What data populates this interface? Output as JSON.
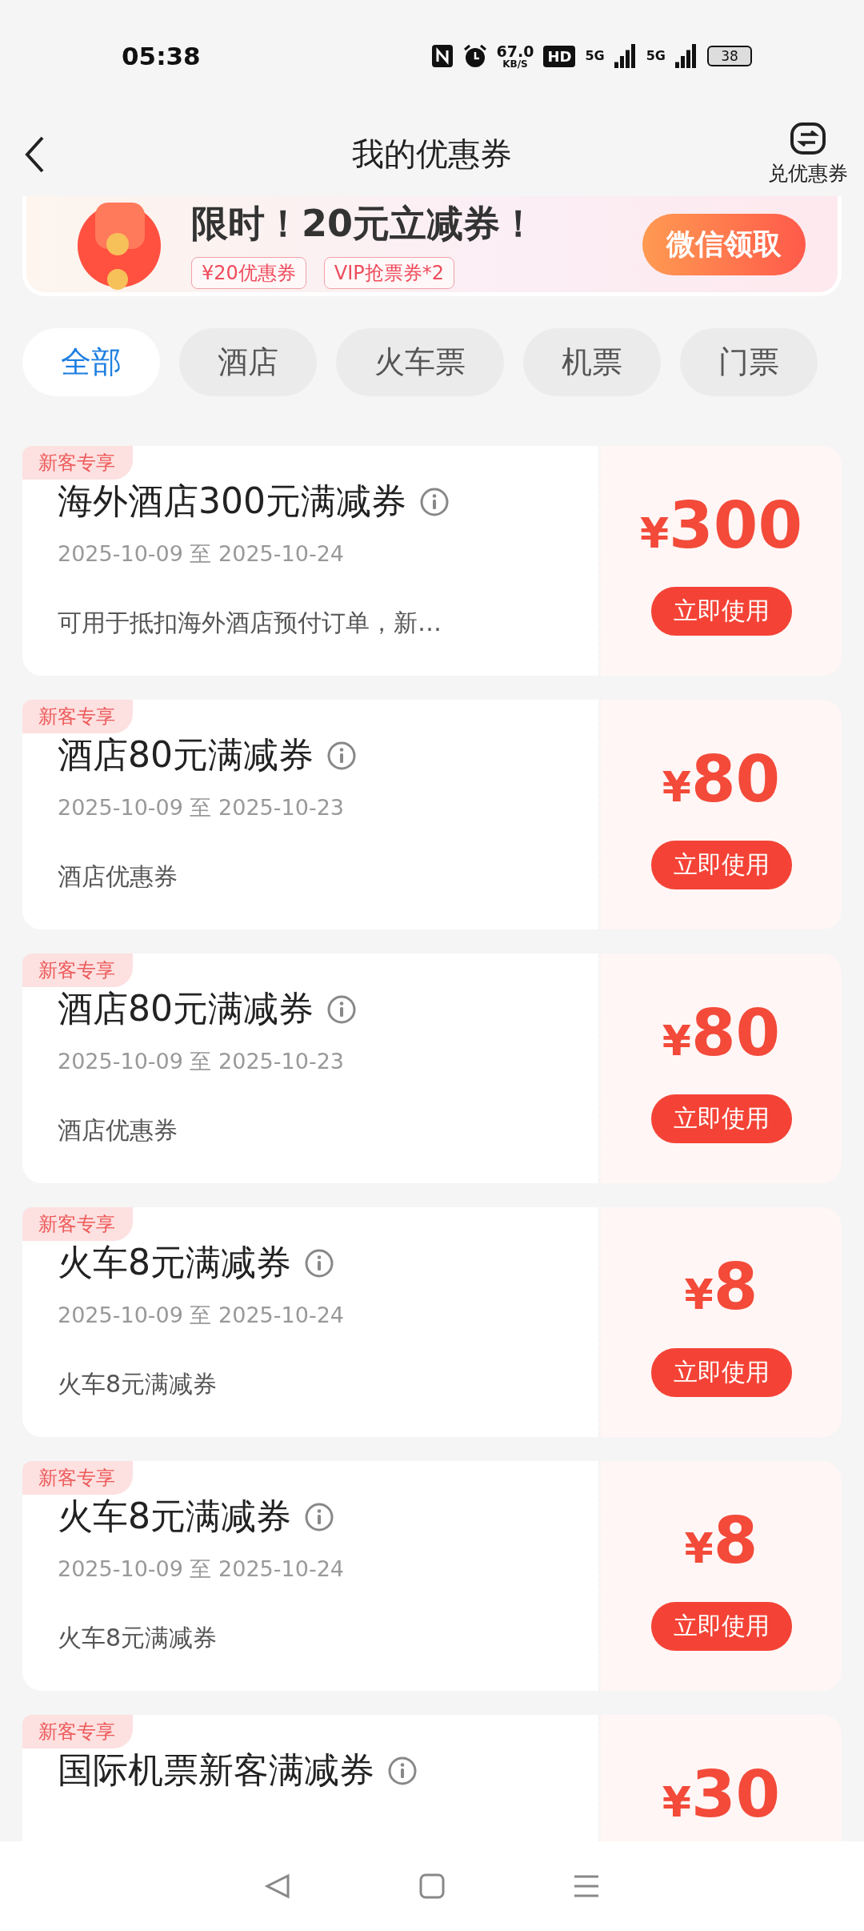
{
  "status_bar": {
    "time": "05:38",
    "speed": "67.0",
    "speed_unit": "KB/S",
    "hd": "HD",
    "network_1": "5G",
    "network_2": "5G",
    "battery": "38"
  },
  "header": {
    "title": "我的优惠券",
    "action": "兑优惠券"
  },
  "banner": {
    "headline": "限时！20元立减券！",
    "chips": [
      "¥20优惠券",
      "VIP抢票券*2"
    ],
    "button": "微信领取"
  },
  "tabs": [
    {
      "label": "全部",
      "selected": true
    },
    {
      "label": "酒店",
      "selected": false
    },
    {
      "label": "火车票",
      "selected": false
    },
    {
      "label": "机票",
      "selected": false
    },
    {
      "label": "门票",
      "selected": false
    }
  ],
  "coupons": [
    {
      "tag": "新客专享",
      "title": "海外酒店300元满减券",
      "dates": "2025-10-09 至 2025-10-24",
      "description": "可用于抵扣海外酒店预付订单，新…",
      "currency": "¥",
      "amount": "300",
      "button": "立即使用"
    },
    {
      "tag": "新客专享",
      "title": "酒店80元满减券",
      "dates": "2025-10-09 至 2025-10-23",
      "description": "酒店优惠券",
      "currency": "¥",
      "amount": "80",
      "button": "立即使用"
    },
    {
      "tag": "新客专享",
      "title": "酒店80元满减券",
      "dates": "2025-10-09 至 2025-10-23",
      "description": "酒店优惠券",
      "currency": "¥",
      "amount": "80",
      "button": "立即使用"
    },
    {
      "tag": "新客专享",
      "title": "火车8元满减券",
      "dates": "2025-10-09 至 2025-10-24",
      "description": "火车8元满减券",
      "currency": "¥",
      "amount": "8",
      "button": "立即使用"
    },
    {
      "tag": "新客专享",
      "title": "火车8元满减券",
      "dates": "2025-10-09 至 2025-10-24",
      "description": "火车8元满减券",
      "currency": "¥",
      "amount": "8",
      "button": "立即使用"
    },
    {
      "tag": "新客专享",
      "title": "国际机票新客满减券",
      "currency": "¥",
      "amount": "30"
    }
  ]
}
